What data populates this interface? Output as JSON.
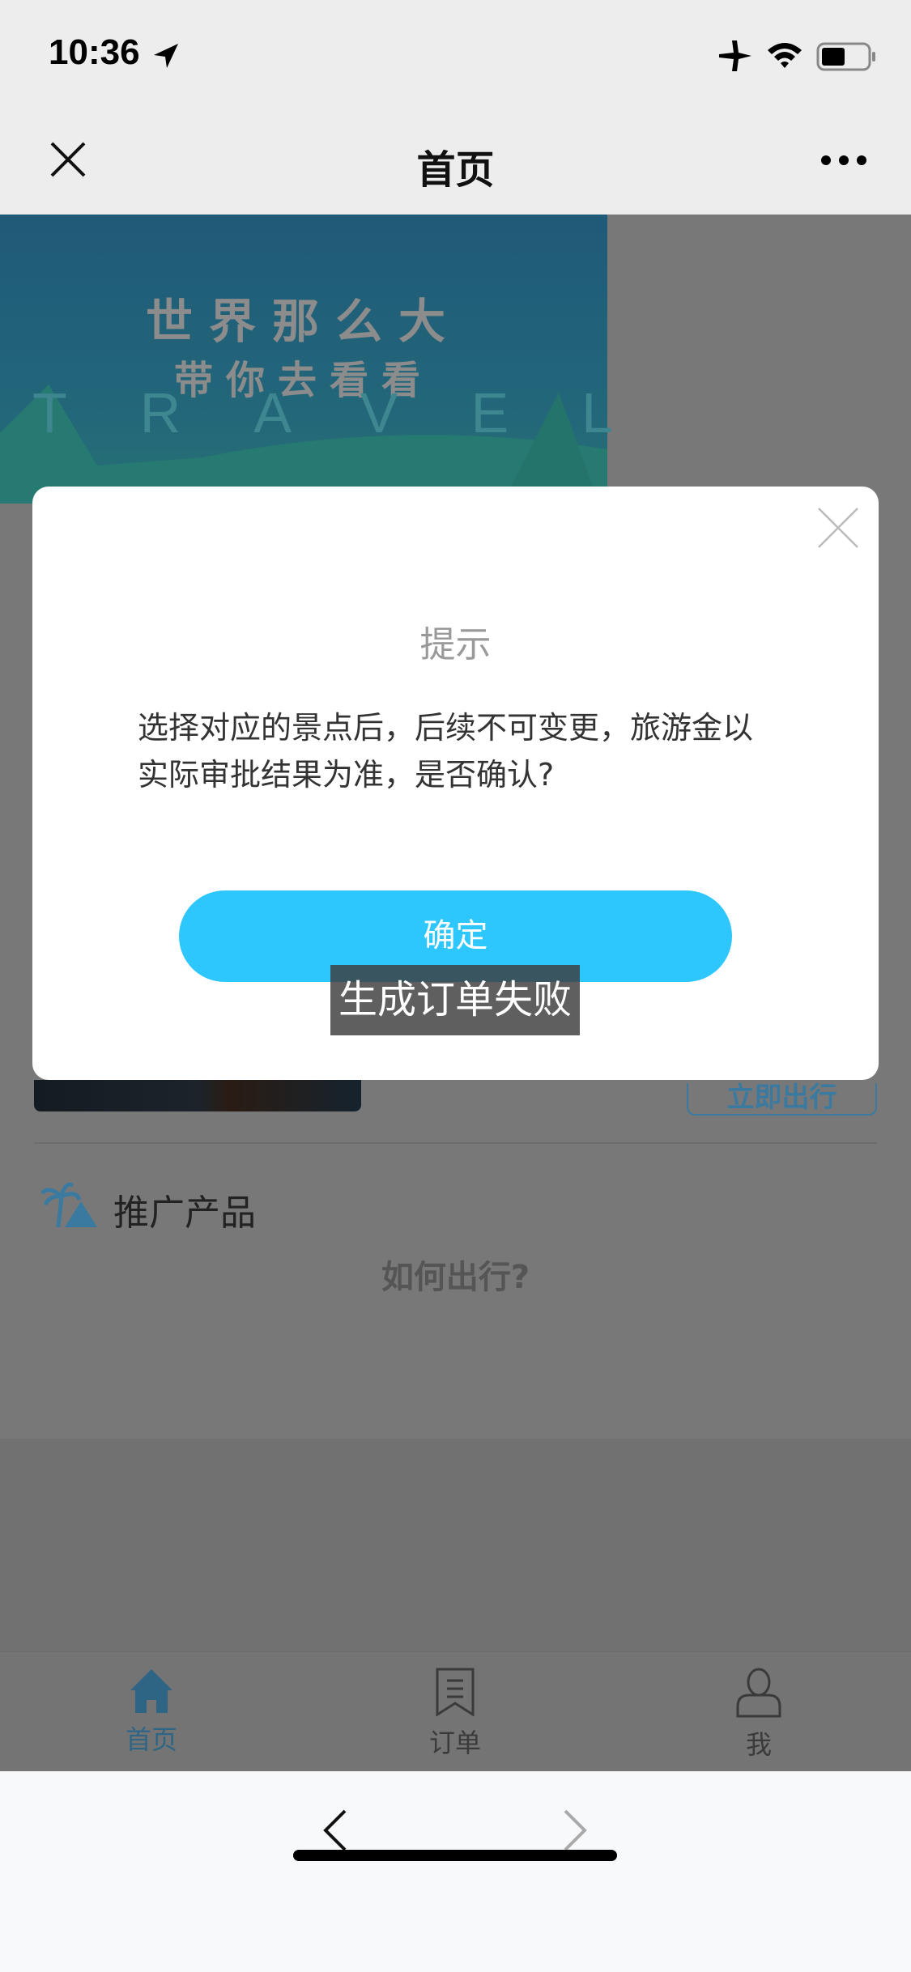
{
  "status_bar": {
    "time": "10:36"
  },
  "nav": {
    "title": "首页"
  },
  "banner": {
    "line1": "世界那么大",
    "line2": "带你去看看",
    "travel": "TRAVEL"
  },
  "page": {
    "go_button": "立即出行",
    "section_title": "推广产品",
    "how_title": "如何出行?"
  },
  "modal": {
    "title": "提示",
    "message": "选择对应的景点后，后续不可变更，旅游金以实际审批结果为准，是否确认?",
    "confirm": "确定"
  },
  "toast": {
    "text": "生成订单失败"
  },
  "tabbar": {
    "items": [
      {
        "label": "首页",
        "icon": "home-icon",
        "active": true
      },
      {
        "label": "订单",
        "icon": "order-icon"
      },
      {
        "label": "我",
        "icon": "user-icon"
      }
    ]
  },
  "colors": {
    "accent": "#2ec7fd",
    "tab_active": "#3a9bd8"
  }
}
